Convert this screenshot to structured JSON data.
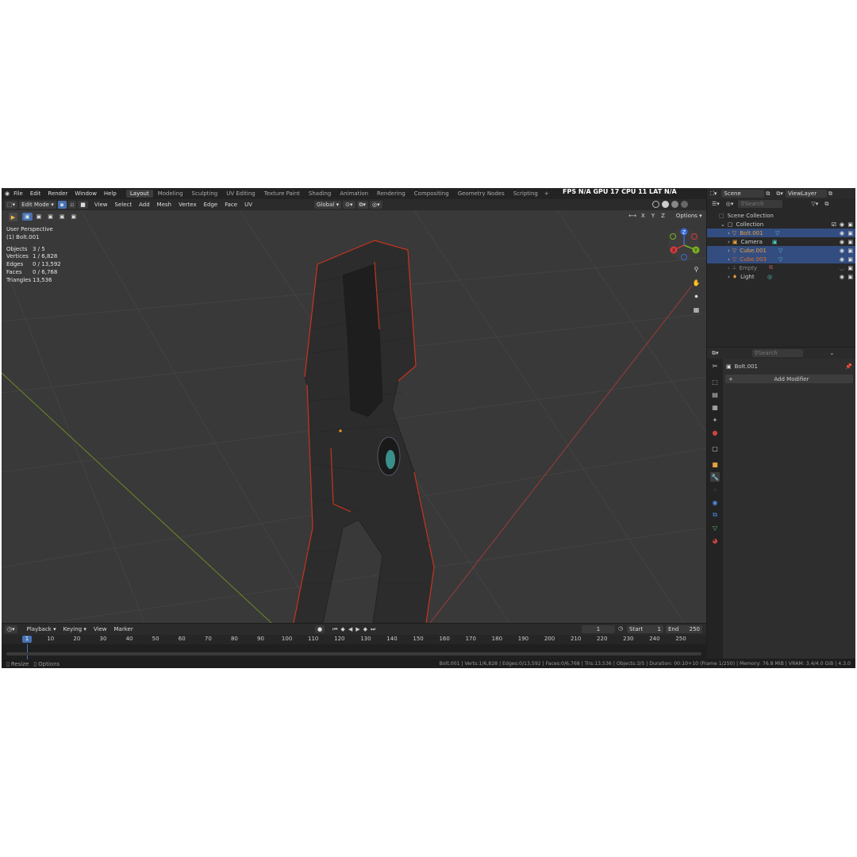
{
  "menus": [
    "File",
    "Edit",
    "Render",
    "Window",
    "Help"
  ],
  "workspaces": [
    "Layout",
    "Modeling",
    "Sculpting",
    "UV Editing",
    "Texture Paint",
    "Shading",
    "Animation",
    "Rendering",
    "Compositing",
    "Geometry Nodes",
    "Scripting"
  ],
  "active_workspace": "Layout",
  "add_workspace": "+",
  "hud": "FPS  N/A  GPU  17  CPU  11  LAT  N/A",
  "scene": {
    "label": "Scene",
    "viewlayer": "ViewLayer"
  },
  "viewport_header": {
    "mode": "Edit Mode",
    "menus": [
      "View",
      "Select",
      "Add",
      "Mesh",
      "Vertex",
      "Edge",
      "Face",
      "UV"
    ],
    "orientation": "Global",
    "axes": [
      "X",
      "Y",
      "Z"
    ],
    "options": "Options"
  },
  "overlay": {
    "perspective": "User Perspective",
    "object": "(1) Bolt.001",
    "stats": [
      {
        "label": "Objects",
        "value": "3 / 5"
      },
      {
        "label": "Vertices",
        "value": "1 / 6,828"
      },
      {
        "label": "Edges",
        "value": "0 / 13,592"
      },
      {
        "label": "Faces",
        "value": "0 / 6,768"
      },
      {
        "label": "Triangles",
        "value": "13,536"
      }
    ]
  },
  "gizmo": {
    "x": "X",
    "y": "Y",
    "z": "Z"
  },
  "outliner": {
    "search_placeholder": "Search",
    "scene_collection": "Scene Collection",
    "collection": "Collection",
    "items": [
      {
        "name": "Bolt.001",
        "selected": true,
        "color": "#e6a040"
      },
      {
        "name": "Camera",
        "selected": false,
        "color": "#dddddd"
      },
      {
        "name": "Cube.001",
        "selected": true,
        "color": "#e6a040"
      },
      {
        "name": "Cube.003",
        "selected": true,
        "color": "#e07030"
      },
      {
        "name": "Empty",
        "selected": false,
        "color": "#888888"
      },
      {
        "name": "Light",
        "selected": false,
        "color": "#dddddd"
      }
    ]
  },
  "properties": {
    "search_placeholder": "Search",
    "object": "Bolt.001",
    "add_modifier": "Add Modifier",
    "plus": "+"
  },
  "timeline": {
    "menus": [
      "Playback",
      "Keying",
      "View",
      "Marker"
    ],
    "current_frame": "1",
    "start_label": "Start",
    "start": "1",
    "end_label": "End",
    "end": "250",
    "ruler": [
      "1",
      "10",
      "20",
      "30",
      "40",
      "50",
      "60",
      "70",
      "80",
      "90",
      "100",
      "110",
      "120",
      "130",
      "140",
      "150",
      "160",
      "170",
      "180",
      "190",
      "200",
      "210",
      "220",
      "230",
      "240",
      "250"
    ]
  },
  "statusbar": {
    "left1": "Resize",
    "left2": "Options",
    "right": "Bolt.001 | Verts:1/6,828 | Edges:0/13,592 | Faces:0/6,768 | Tris:13,536 | Objects:3/5 | Duration: 00:10+10 (Frame 1/250) | Memory: 76.8 MiB | VRAM: 3.4/4.0 GiB | 4.3.0"
  },
  "colors": {
    "accent": "#4772b3",
    "selected_row": "#334d80",
    "edge_select": "#e03020"
  }
}
